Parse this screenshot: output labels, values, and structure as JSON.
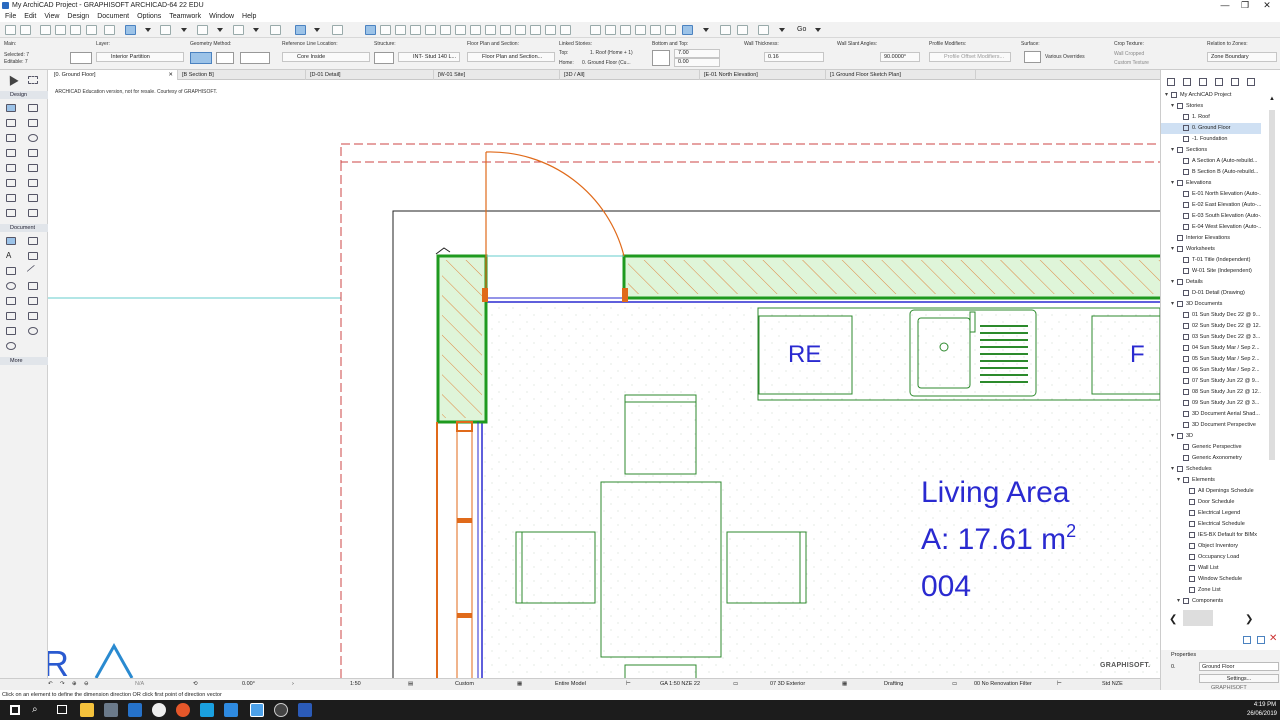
{
  "window": {
    "title": "My ArchiCAD Project - GRAPHISOFT ARCHICAD-64 22 EDU",
    "minimize": "—",
    "maximize": "❐",
    "close": "✕"
  },
  "menu": [
    "File",
    "Edit",
    "View",
    "Design",
    "Document",
    "Options",
    "Teamwork",
    "Window",
    "Help"
  ],
  "toolbar": {
    "go_label": "Go"
  },
  "infobox": {
    "main_label": "Main:",
    "selected": "Selected: 7",
    "editable": "Editable: 7",
    "layer_label": "Layer:",
    "layer_value": "Interior Partition",
    "geometry_label": "Geometry Method:",
    "refline_label": "Reference Line Location:",
    "refline_value": "Core Inside",
    "structure_label": "Structure:",
    "structure_value": "INT- Stud 140 L...",
    "floorplan_label": "Floor Plan and Section:",
    "floorplan_value": "Floor Plan and Section...",
    "stories_label": "Linked Stories:",
    "top_label": "Top:",
    "top_value": "1. Roof (Home + 1)",
    "home_label": "Home:",
    "home_value": "0. Ground Floor (Cu...",
    "bottom_top_label": "Bottom and Top:",
    "top_offset": "7.00",
    "bottom_offset": "0.00",
    "thickness_label": "Wall Thickness:",
    "thickness_value": "0.16",
    "slant_label": "Wall Slant Angles:",
    "slant_value": "90.0000°",
    "profile_label": "Profile Modifiers:",
    "profile_value": "Profile Offset Modifiers...",
    "surface_label": "Surface:",
    "surface_value": "Various Overrides",
    "crop_label": "Crop Texture:",
    "wall_cropped": "Wall Cropped",
    "custom_texture": "Custom Texture",
    "relation_label": "Relation to Zones:",
    "relation_value": "Zone Boundary"
  },
  "tabs": [
    {
      "label": "[0. Ground Floor]",
      "active": true
    },
    {
      "label": "[B Section B]"
    },
    {
      "label": "[D-01 Detail]"
    },
    {
      "label": "[W-01 Site]"
    },
    {
      "label": "[3D / All]"
    },
    {
      "label": "[E-01 North Elevation]"
    },
    {
      "label": "[1 Ground Floor Sketch Plan]"
    }
  ],
  "toolbox": {
    "design_header": "Design",
    "document_header": "Document",
    "more_header": "More"
  },
  "canvas": {
    "notice": "ARCHICAD Education version, not for resale. Courtesy of GRAPHISOFT.",
    "zone_name": "Living Area",
    "zone_area": "A: 17.61 m",
    "zone_area_sup": "2",
    "zone_number": "004",
    "label_re": "RE",
    "label_f": "F",
    "watermark": "GRAPHISOFT.",
    "logo_letter": "R"
  },
  "navigator": {
    "items": [
      {
        "label": "My ArchiCAD Project",
        "level": 0,
        "toggle": "▾"
      },
      {
        "label": "Stories",
        "level": 1,
        "toggle": "▾"
      },
      {
        "label": "1. Roof",
        "level": 2
      },
      {
        "label": "0. Ground Floor",
        "level": 2,
        "selected": true
      },
      {
        "label": "-1. Foundation",
        "level": 2
      },
      {
        "label": "Sections",
        "level": 1,
        "toggle": "▾"
      },
      {
        "label": "A Section A (Auto-rebuild...",
        "level": 2
      },
      {
        "label": "B Section B (Auto-rebuild...",
        "level": 2
      },
      {
        "label": "Elevations",
        "level": 1,
        "toggle": "▾"
      },
      {
        "label": "E-01 North Elevation (Auto-...",
        "level": 2
      },
      {
        "label": "E-02 East Elevation (Auto-...",
        "level": 2
      },
      {
        "label": "E-03 South Elevation (Auto-...",
        "level": 2
      },
      {
        "label": "E-04 West Elevation (Auto-...",
        "level": 2
      },
      {
        "label": "Interior Elevations",
        "level": 1
      },
      {
        "label": "Worksheets",
        "level": 1,
        "toggle": "▾"
      },
      {
        "label": "T-01 Title (Independent)",
        "level": 2
      },
      {
        "label": "W-01 Site (Independent)",
        "level": 2
      },
      {
        "label": "Details",
        "level": 1,
        "toggle": "▾"
      },
      {
        "label": "D-01 Detail (Drawing)",
        "level": 2
      },
      {
        "label": "3D Documents",
        "level": 1,
        "toggle": "▾"
      },
      {
        "label": "01 Sun Study Dec 22 @ 9...",
        "level": 2
      },
      {
        "label": "02 Sun Study Dec 22 @ 12...",
        "level": 2
      },
      {
        "label": "03 Sun Study Dec 22 @ 3...",
        "level": 2
      },
      {
        "label": "04 Sun Study Mar / Sep 2...",
        "level": 2
      },
      {
        "label": "05 Sun Study Mar / Sep 2...",
        "level": 2
      },
      {
        "label": "06 Sun Study Mar / Sep 2...",
        "level": 2
      },
      {
        "label": "07 Sun Study Jun 22 @ 9...",
        "level": 2
      },
      {
        "label": "08 Sun Study Jun 22 @ 12...",
        "level": 2
      },
      {
        "label": "09 Sun Study Jun 22 @ 3...",
        "level": 2
      },
      {
        "label": "3D Document Aerial Shad...",
        "level": 2
      },
      {
        "label": "3D Document Perspective",
        "level": 2
      },
      {
        "label": "3D",
        "level": 1,
        "toggle": "▾"
      },
      {
        "label": "Generic Perspective",
        "level": 2
      },
      {
        "label": "Generic Axonometry",
        "level": 2
      },
      {
        "label": "Schedules",
        "level": 1,
        "toggle": "▾"
      },
      {
        "label": "Elements",
        "level": 2,
        "toggle": "▾"
      },
      {
        "label": "All Openings Schedule",
        "level": 3
      },
      {
        "label": "Door Schedule",
        "level": 3
      },
      {
        "label": "Electrical Legend",
        "level": 3
      },
      {
        "label": "Electrical Schedule",
        "level": 3
      },
      {
        "label": "IES-BX Default for BIMx",
        "level": 3
      },
      {
        "label": "Object Inventory",
        "level": 3
      },
      {
        "label": "Occupancy Load",
        "level": 3
      },
      {
        "label": "Wall List",
        "level": 3
      },
      {
        "label": "Window Schedule",
        "level": 3
      },
      {
        "label": "Zone List",
        "level": 3
      },
      {
        "label": "Components",
        "level": 2,
        "toggle": "▾"
      }
    ]
  },
  "properties": {
    "title": "Properties",
    "id": "0.",
    "name": "Ground Floor",
    "settings": "Settings...",
    "logo": "GRAPHISOFT"
  },
  "statusbar": {
    "undo": "N/A",
    "angle": "0.00°",
    "scale": "1:50",
    "pen_set": "Custom",
    "model": "Entire Model",
    "mvo": "GA 1:50 NZE 22",
    "view": "07 3D Exterior",
    "drafting": "Drafting",
    "renovation": "00 No Renovation Filter",
    "dim": "Std NZE"
  },
  "hint": "Click on an element to define the dimension direction OR click first point of direction vector",
  "taskbar": {
    "time": "4:19 PM",
    "date": "26/06/2019"
  },
  "colors": {
    "wall_green": "#1f9a1f",
    "wall_fill": "#dff5d9",
    "door_orange": "#e06a1a",
    "zone_blue": "#2a2ad0",
    "furniture_green": "#2c8a2c"
  }
}
